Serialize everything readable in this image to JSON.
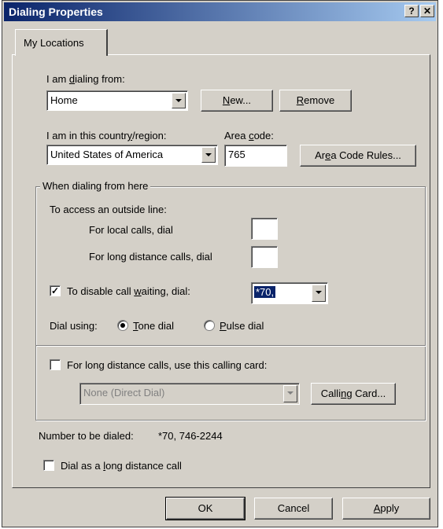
{
  "window": {
    "title": "Dialing Properties",
    "help_glyph": "?",
    "close_glyph": "✕"
  },
  "tabs": [
    {
      "label": "My Locations"
    }
  ],
  "location": {
    "label_pre": "I am ",
    "label_u": "d",
    "label_post": "ialing from:",
    "value": "Home",
    "new_u": "N",
    "new_post": "ew...",
    "remove_u": "R",
    "remove_post": "emove"
  },
  "country": {
    "label_pre": "I am in this countr",
    "label_u": "y",
    "label_post": "/region:",
    "value": "United States of America"
  },
  "area_code": {
    "label_pre": "Area ",
    "label_u": "c",
    "label_post": "ode:",
    "value": "765",
    "rules_pre": "Ar",
    "rules_u": "e",
    "rules_post": "a Code Rules..."
  },
  "dialing_group": {
    "label": "When dialing from here",
    "outside_line_label": "To access an outside line:",
    "local_label": "For local calls, dial",
    "local_value": "",
    "long_label": "For long distance calls, dial",
    "long_value": "",
    "call_waiting_checked": true,
    "call_waiting_pre": "To disable call ",
    "call_waiting_u": "w",
    "call_waiting_post": "aiting, dial:",
    "call_waiting_value": "*70,",
    "dial_using_label": "Dial using:",
    "tone_u": "T",
    "tone_post": "one dial",
    "pulse_u": "P",
    "pulse_post": "ulse dial",
    "selected_mode": "tone",
    "calling_card_checked": false,
    "calling_card_label": "For long distance calls, use this calling card:",
    "calling_card_value": "None (Direct Dial)",
    "calling_card_btn_pre": "Calli",
    "calling_card_btn_u": "n",
    "calling_card_btn_post": "g Card..."
  },
  "number_to_dial": {
    "label": "Number to be dialed:",
    "value": "*70, 746-2244"
  },
  "long_distance": {
    "checked": false,
    "pre": "Dial as a ",
    "u": "l",
    "post": "ong distance call"
  },
  "footer": {
    "ok": "OK",
    "cancel": "Cancel",
    "apply_u": "A",
    "apply_post": "pply"
  }
}
